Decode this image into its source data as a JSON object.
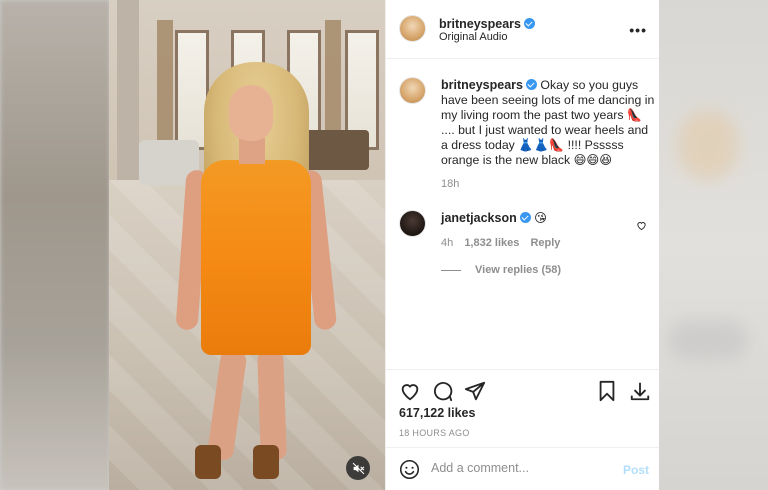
{
  "post": {
    "author": "britneyspears",
    "audio": "Original Audio",
    "more_icon": "more-horizontal-icon"
  },
  "caption": {
    "author": "britneyspears",
    "text": "Okay so you guys have been seeing lots of me dancing in my living room the past two years 👠 .... but I just wanted to wear heels and a dress today 👗👗👠 !!!! Psssss orange is the new black 😄😄😆",
    "time": "18h"
  },
  "comment": {
    "author": "janetjackson",
    "text": "😘",
    "time": "4h",
    "likes": "1,832 likes",
    "reply_label": "Reply",
    "view_replies": "View replies (58)"
  },
  "stats": {
    "likes": "617,122 likes",
    "timestamp": "18 HOURS AGO"
  },
  "comment_bar": {
    "placeholder": "Add a comment...",
    "post_label": "Post"
  },
  "colors": {
    "verified": "#3897f0",
    "post_disabled": "#b2dffc",
    "dress": "#f58a14"
  }
}
